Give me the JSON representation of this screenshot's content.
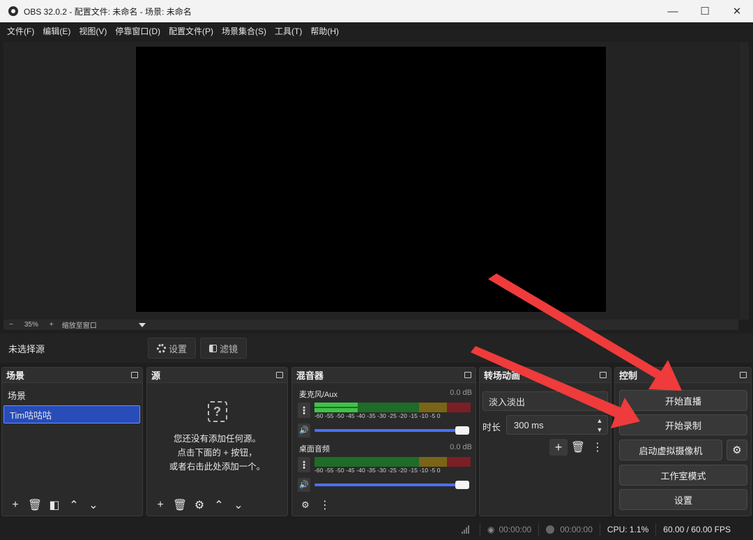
{
  "window": {
    "title": "OBS 32.0.2 - 配置文件: 未命名 - 场景: 未命名",
    "minimize": "—",
    "maximize": "☐",
    "close": "✕"
  },
  "menu": [
    "文件(F)",
    "编辑(E)",
    "视图(V)",
    "停靠窗口(D)",
    "配置文件(P)",
    "场景集合(S)",
    "工具(T)",
    "帮助(H)"
  ],
  "zoom": {
    "minus": "−",
    "level": "35%",
    "plus": "+",
    "fit_label": "缩放至窗口"
  },
  "source_toolbar": {
    "no_source": "未选择源",
    "properties": "设置",
    "filters": "滤镜"
  },
  "scenes": {
    "title": "场景",
    "items": [
      {
        "label": "场景"
      },
      {
        "label": "Tim咕咕咕"
      }
    ]
  },
  "sources": {
    "title": "源",
    "empty_line1": "您还没有添加任何源。",
    "empty_line2": "点击下面的 + 按钮，",
    "empty_line3": "或者右击此处添加一个。"
  },
  "mixer": {
    "title": "混音器",
    "scale": "-60 -55 -50 -45 -40 -35 -30 -25 -20 -15 -10 -5 0",
    "tracks": [
      {
        "name": "麦克风/Aux",
        "db": "0.0 dB",
        "volume": 1.0
      },
      {
        "name": "桌面音频",
        "db": "0.0 dB",
        "volume": 1.0
      }
    ]
  },
  "transitions": {
    "title": "转场动画",
    "selected": "淡入淡出",
    "duration_label": "时长",
    "duration_value": "300 ms"
  },
  "controls": {
    "title": "控制",
    "start_stream": "开始直播",
    "start_record": "开始录制",
    "start_vcam": "启动虚拟摄像机",
    "studio_mode": "工作室模式",
    "settings": "设置"
  },
  "status": {
    "stream_time": "00:00:00",
    "record_time": "00:00:00",
    "cpu": "CPU: 1.1%",
    "fps": "60.00 / 60.00 FPS"
  },
  "colors": {
    "accent": "#284cb8",
    "annotation_arrow": "#ef3b3b",
    "meter_green": "#3fc24a",
    "meter_yellow": "#c8a22a",
    "meter_red": "#c0343b"
  }
}
